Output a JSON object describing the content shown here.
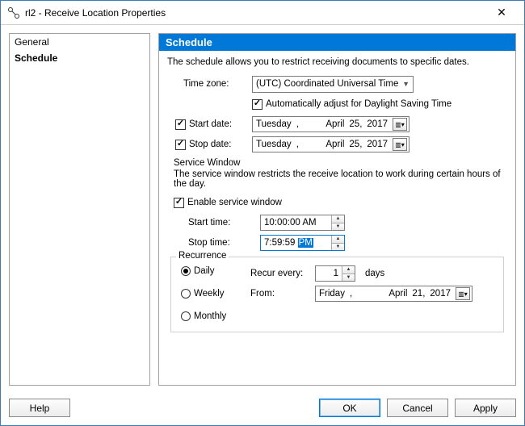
{
  "window": {
    "title": "rl2 - Receive Location Properties"
  },
  "sidebar": {
    "items": [
      {
        "label": "General"
      },
      {
        "label": "Schedule"
      }
    ]
  },
  "header": {
    "title": "Schedule"
  },
  "schedule": {
    "description": "The schedule allows you to restrict receiving documents to specific dates.",
    "timezone_label": "Time zone:",
    "timezone_value": "(UTC) Coordinated Universal Time",
    "dst_label": "Automatically adjust for Daylight Saving Time",
    "start_date_label": "Start date:",
    "start_date": {
      "weekday": "Tuesday",
      "month": "April",
      "day": "25,",
      "year": "2017"
    },
    "stop_date_label": "Stop date:",
    "stop_date": {
      "weekday": "Tuesday",
      "month": "April",
      "day": "25,",
      "year": "2017"
    }
  },
  "service_window": {
    "legend": "Service Window",
    "description": "The service window restricts the receive location to work during certain hours of the day.",
    "enable_label": "Enable service window",
    "start_time_label": "Start time:",
    "start_time_value": "10:00:00 AM",
    "stop_time_label": "Stop time:",
    "stop_time_prefix": "7:59:59 ",
    "stop_time_selected": "PM"
  },
  "recurrence": {
    "legend": "Recurrence",
    "options": {
      "daily": "Daily",
      "weekly": "Weekly",
      "monthly": "Monthly"
    },
    "recur_every_label": "Recur every:",
    "recur_every_value": "1",
    "recur_every_unit": "days",
    "from_label": "From:",
    "from_date": {
      "weekday": "Friday",
      "month": "April",
      "day": "21,",
      "year": "2017"
    }
  },
  "buttons": {
    "help": "Help",
    "ok": "OK",
    "cancel": "Cancel",
    "apply": "Apply"
  }
}
